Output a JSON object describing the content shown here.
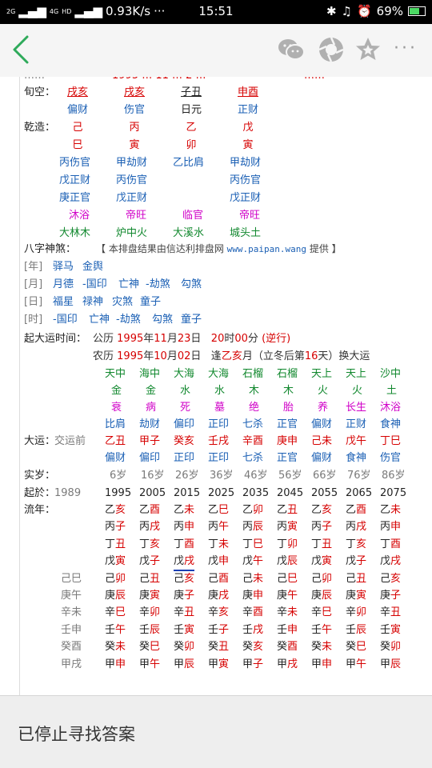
{
  "status_bar": {
    "signal_left": "2G",
    "network_type": "4G",
    "hd": "HD",
    "net_speed": "0.93K/s",
    "dots": "···",
    "time": "15:51",
    "battery": "69%",
    "battery_level": 0.69
  },
  "nav": {
    "more": "···"
  },
  "chart": {
    "top_partial": [
      "……",
      "1995 … 11 … 2 …",
      "……"
    ],
    "xunkong": {
      "label": "旬空：",
      "cols": [
        "戌亥",
        "戌亥",
        "子丑",
        "申酉"
      ]
    },
    "shishen": [
      "偏财",
      "伤官",
      "日元",
      "正财"
    ],
    "qianzao_label": "乾造：",
    "tiangan": [
      "己",
      "丙",
      "乙",
      "戊"
    ],
    "dizhi": [
      "巳",
      "寅",
      "卯",
      "寅"
    ],
    "canggan": [
      [
        "丙伤官",
        "甲劫财",
        "乙比肩",
        "甲劫财"
      ],
      [
        "戊正财",
        "丙伤官",
        "",
        "丙伤官"
      ],
      [
        "庚正官",
        "戊正财",
        "",
        "戊正财"
      ]
    ],
    "changsheng": [
      "沐浴",
      "帝旺",
      "临官",
      "帝旺"
    ],
    "nayin": [
      "大林木",
      "炉中火",
      "大溪水",
      "城头土"
    ],
    "shensha_label": "八字神煞：",
    "shensha_info_prefix": "【 本排盘结果由信达利排盘网",
    "shensha_info_url": "www.paipan.wang",
    "shensha_info_suffix": "提供 】",
    "shensha": [
      {
        "label": "[年]",
        "items": [
          "驿马",
          "金舆"
        ]
      },
      {
        "label": "[月]",
        "items": [
          "月德",
          "-国印",
          "亡神",
          "-劫煞",
          "勾煞"
        ]
      },
      {
        "label": "[日]",
        "items": [
          "福星",
          "禄神",
          "灾煞",
          "童子"
        ]
      },
      {
        "label": "[时]",
        "items": [
          "-国印",
          "亡神",
          "-劫煞",
          "勾煞",
          "童子"
        ]
      }
    ],
    "qiyun": {
      "label": "起大运时间：",
      "gongli": "公历",
      "year1": "1995",
      "nian": "年",
      "month1": "11",
      "yue": "月",
      "day1": "23",
      "ri": "日",
      "hour": "20",
      "shi": "时",
      "minute": "00",
      "fen": "分",
      "direction": "(逆行)",
      "nongli": "农历",
      "year2": "1995",
      "month2": "10",
      "day2": "02",
      "feng": "逢",
      "gan": "乙",
      "zhi": "亥",
      "yue2": "月（立冬后第",
      "days": "16",
      "tian": "天）换大运"
    },
    "dayun_label": "大运：",
    "jiaoyunqian": "交运前",
    "shishen_top": [
      "比肩",
      "劫财",
      "偏印",
      "正印",
      "七杀",
      "正官",
      "偏财",
      "正财",
      "食神"
    ],
    "dayun_top_gan": [
      "天中",
      "海中",
      "大海",
      "大海",
      "石榴",
      "石榴",
      "天上",
      "天上",
      "沙中"
    ],
    "dayun_wuxing": [
      "金",
      "金",
      "水",
      "水",
      "木",
      "木",
      "火",
      "火",
      "土"
    ],
    "dayun_changsheng": [
      "衰",
      "病",
      "死",
      "墓",
      "绝",
      "胎",
      "养",
      "长生",
      "沐浴"
    ],
    "dayun_ganzhi": [
      "乙丑",
      "甲子",
      "癸亥",
      "壬戌",
      "辛酉",
      "庚申",
      "己未",
      "戊午",
      "丁巳"
    ],
    "dayun_zhishen": [
      "偏财",
      "偏印",
      "正印",
      "正印",
      "七杀",
      "正官",
      "偏财",
      "食神",
      "伤官"
    ],
    "shisui_label": "实岁：",
    "shisui": [
      "6岁",
      "16岁",
      "26岁",
      "36岁",
      "46岁",
      "56岁",
      "66岁",
      "76岁",
      "86岁"
    ],
    "qiyu_label": "起於：",
    "qiyu_first": "1989",
    "qiyu": [
      "1995",
      "2005",
      "2015",
      "2025",
      "2035",
      "2045",
      "2055",
      "2065",
      "2075"
    ],
    "liunian_label": "流年：",
    "liunian_left": [
      "",
      "",
      "",
      "",
      "己巳",
      "庚午",
      "辛未",
      "壬申",
      "癸酉",
      "甲戌"
    ],
    "liunian": [
      [
        "乙亥",
        "乙酉",
        "乙未",
        "乙巳",
        "乙卯",
        "乙丑",
        "乙亥",
        "乙酉",
        "乙未"
      ],
      [
        "丙子",
        "丙戌",
        "丙申",
        "丙午",
        "丙辰",
        "丙寅",
        "丙子",
        "丙戌",
        "丙申"
      ],
      [
        "丁丑",
        "丁亥",
        "丁酉",
        "丁未",
        "丁巳",
        "丁卯",
        "丁丑",
        "丁亥",
        "丁酉"
      ],
      [
        "戊寅",
        "戊子",
        "戊戌",
        "戊申",
        "戊午",
        "戊辰",
        "戊寅",
        "戊子",
        "戊戌"
      ],
      [
        "己卯",
        "己丑",
        "己亥",
        "己酉",
        "己未",
        "己巳",
        "己卯",
        "己丑",
        "己亥"
      ],
      [
        "庚辰",
        "庚寅",
        "庚子",
        "庚戌",
        "庚申",
        "庚午",
        "庚辰",
        "庚寅",
        "庚子"
      ],
      [
        "辛巳",
        "辛卯",
        "辛丑",
        "辛亥",
        "辛酉",
        "辛未",
        "辛巳",
        "辛卯",
        "辛丑"
      ],
      [
        "壬午",
        "壬辰",
        "壬寅",
        "壬子",
        "壬戌",
        "壬申",
        "壬午",
        "壬辰",
        "壬寅"
      ],
      [
        "癸未",
        "癸巳",
        "癸卯",
        "癸丑",
        "癸亥",
        "癸酉",
        "癸未",
        "癸巳",
        "癸卯"
      ],
      [
        "甲申",
        "甲午",
        "甲辰",
        "甲寅",
        "甲子",
        "甲戌",
        "甲申",
        "甲午",
        "甲辰"
      ]
    ]
  },
  "bottom": {
    "message": "已停止寻找答案"
  }
}
